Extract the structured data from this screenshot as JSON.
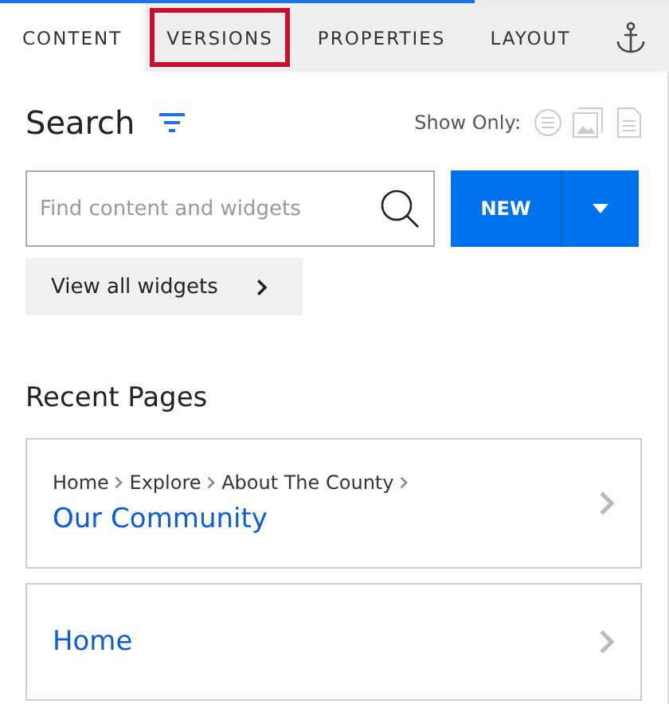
{
  "loading_bar": {
    "level": 0.71
  },
  "tabs": [
    {
      "label": "CONTENT",
      "selected": true,
      "highlighted": false
    },
    {
      "label": "VERSIONS",
      "selected": false,
      "highlighted": true
    },
    {
      "label": "PROPERTIES",
      "selected": false,
      "highlighted": false
    },
    {
      "label": "LAYOUT",
      "selected": false,
      "highlighted": false
    },
    {
      "kind": "icon",
      "selected": false,
      "highlighted": false
    }
  ],
  "search": {
    "title": "Search",
    "show_only_label": "Show Only:",
    "placeholder": "Find content and widgets",
    "new_button": "NEW",
    "view_all": "View all widgets"
  },
  "recent_pages": {
    "title": "Recent Pages",
    "items": [
      {
        "breadcrumbs": [
          "Home",
          "Explore",
          "About The County"
        ],
        "title": "Our Community"
      },
      {
        "title": "Home"
      }
    ]
  }
}
